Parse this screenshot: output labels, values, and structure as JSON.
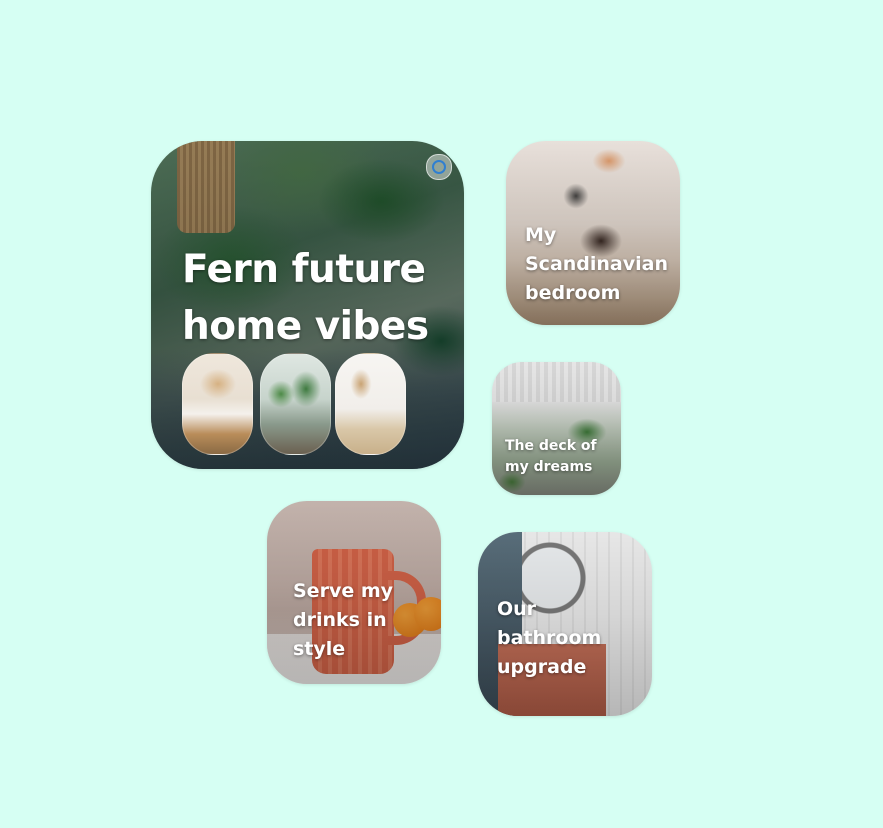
{
  "boards": {
    "fern": {
      "title": "Fern future home vibes"
    },
    "scandinavian": {
      "title": "My Scandinavian bedroom"
    },
    "deck": {
      "title": "The deck of my dreams"
    },
    "drinks": {
      "title": "Serve my drinks in style"
    },
    "bathroom": {
      "title": "Our bathroom upgrade"
    }
  },
  "icons": {
    "visual_search": "visual-search-icon"
  },
  "colors": {
    "background": "#d6fff3",
    "title_text": "#ffffff"
  }
}
